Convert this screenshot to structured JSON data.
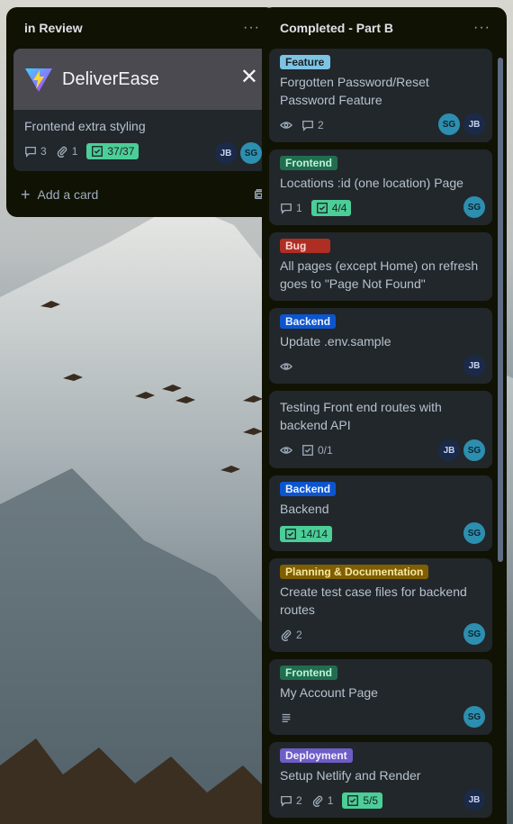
{
  "lists": [
    {
      "title": "in Review",
      "menu": "···",
      "cover": {
        "app_name": "DeliverEase",
        "close": "✕"
      },
      "cards": [
        {
          "title": "Frontend extra styling",
          "comments": "3",
          "attachments": "1",
          "checklist": "37/37",
          "members": [
            "JB",
            "SG"
          ]
        }
      ],
      "add_card_label": "Add a card"
    },
    {
      "title": "Completed - Part B",
      "menu": "···",
      "cards": [
        {
          "label": "Feature",
          "label_color": "#7dc4e4",
          "title": "Forgotten Password/Reset Password Feature",
          "comments": "2",
          "members": [
            "SG",
            "JB"
          ]
        },
        {
          "label": "Frontend",
          "label_color": "#216e4e",
          "title": "Locations :id (one location) Page",
          "comments": "1",
          "checklist": "4/4",
          "members": [
            "SG"
          ]
        },
        {
          "label": "Bug",
          "label_color": "#ae2e24",
          "title": "All pages (except Home) on refresh goes to \"Page Not Found\""
        },
        {
          "label": "Backend",
          "label_color": "#0c55cf",
          "title": "Update .env.sample",
          "members": [
            "JB"
          ]
        },
        {
          "title": "Testing Front end routes with backend API",
          "checklist_plain": "0/1",
          "members": [
            "JB",
            "SG"
          ]
        },
        {
          "label": "Backend",
          "label_color": "#0c55cf",
          "title": "Backend",
          "checklist": "14/14",
          "members": [
            "SG"
          ]
        },
        {
          "label": "Planning & Documentation",
          "label_color": "#7f5f01",
          "title": "Create test case files for backend routes",
          "attachments": "2",
          "members": [
            "SG"
          ]
        },
        {
          "label": "Frontend",
          "label_color": "#216e4e",
          "title": "My Account Page",
          "members": [
            "SG"
          ]
        },
        {
          "label": "Deployment",
          "label_color": "#6e5dc6",
          "title": "Setup Netlify and Render",
          "comments": "2",
          "attachments": "1",
          "checklist": "5/5",
          "members": [
            "JB"
          ]
        }
      ]
    }
  ]
}
